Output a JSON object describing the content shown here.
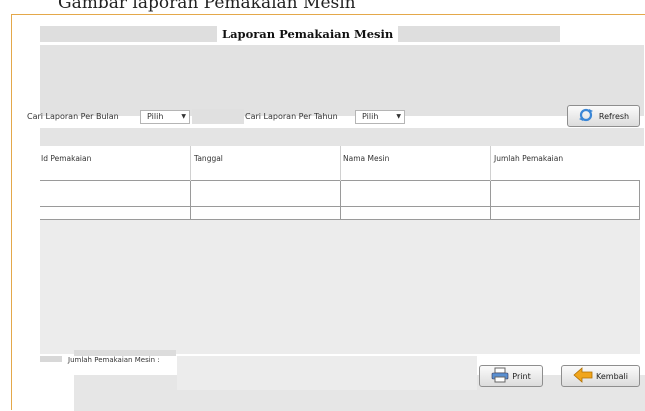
{
  "caption": "Gambar laporan Pemakaian Mesin",
  "form": {
    "title": "Laporan Pemakaian Mesin",
    "month_label": "Cari Laporan Per Bulan",
    "month_value": "Pilih",
    "year_label": "Cari Laporan Per Tahun",
    "year_value": "Pilih",
    "refresh_button": "Refresh",
    "print_button": "Print",
    "back_button": "Kembali",
    "total_label": "Jumlah Pemakaian Mesin :"
  },
  "table": {
    "columns": [
      "Id Pemakaian",
      "Tanggal",
      "Nama Mesin",
      "Jumlah Pemakaian"
    ],
    "rows": [
      [
        "",
        "",
        "",
        ""
      ],
      [
        "",
        "",
        "",
        ""
      ]
    ]
  },
  "colors": {
    "window_border": "#e4a84a",
    "panel": "#e8e8e8",
    "grid": "#9a9a9a"
  },
  "icons": {
    "refresh": "refresh-icon",
    "print": "printer-icon",
    "back": "back-arrow-icon"
  }
}
